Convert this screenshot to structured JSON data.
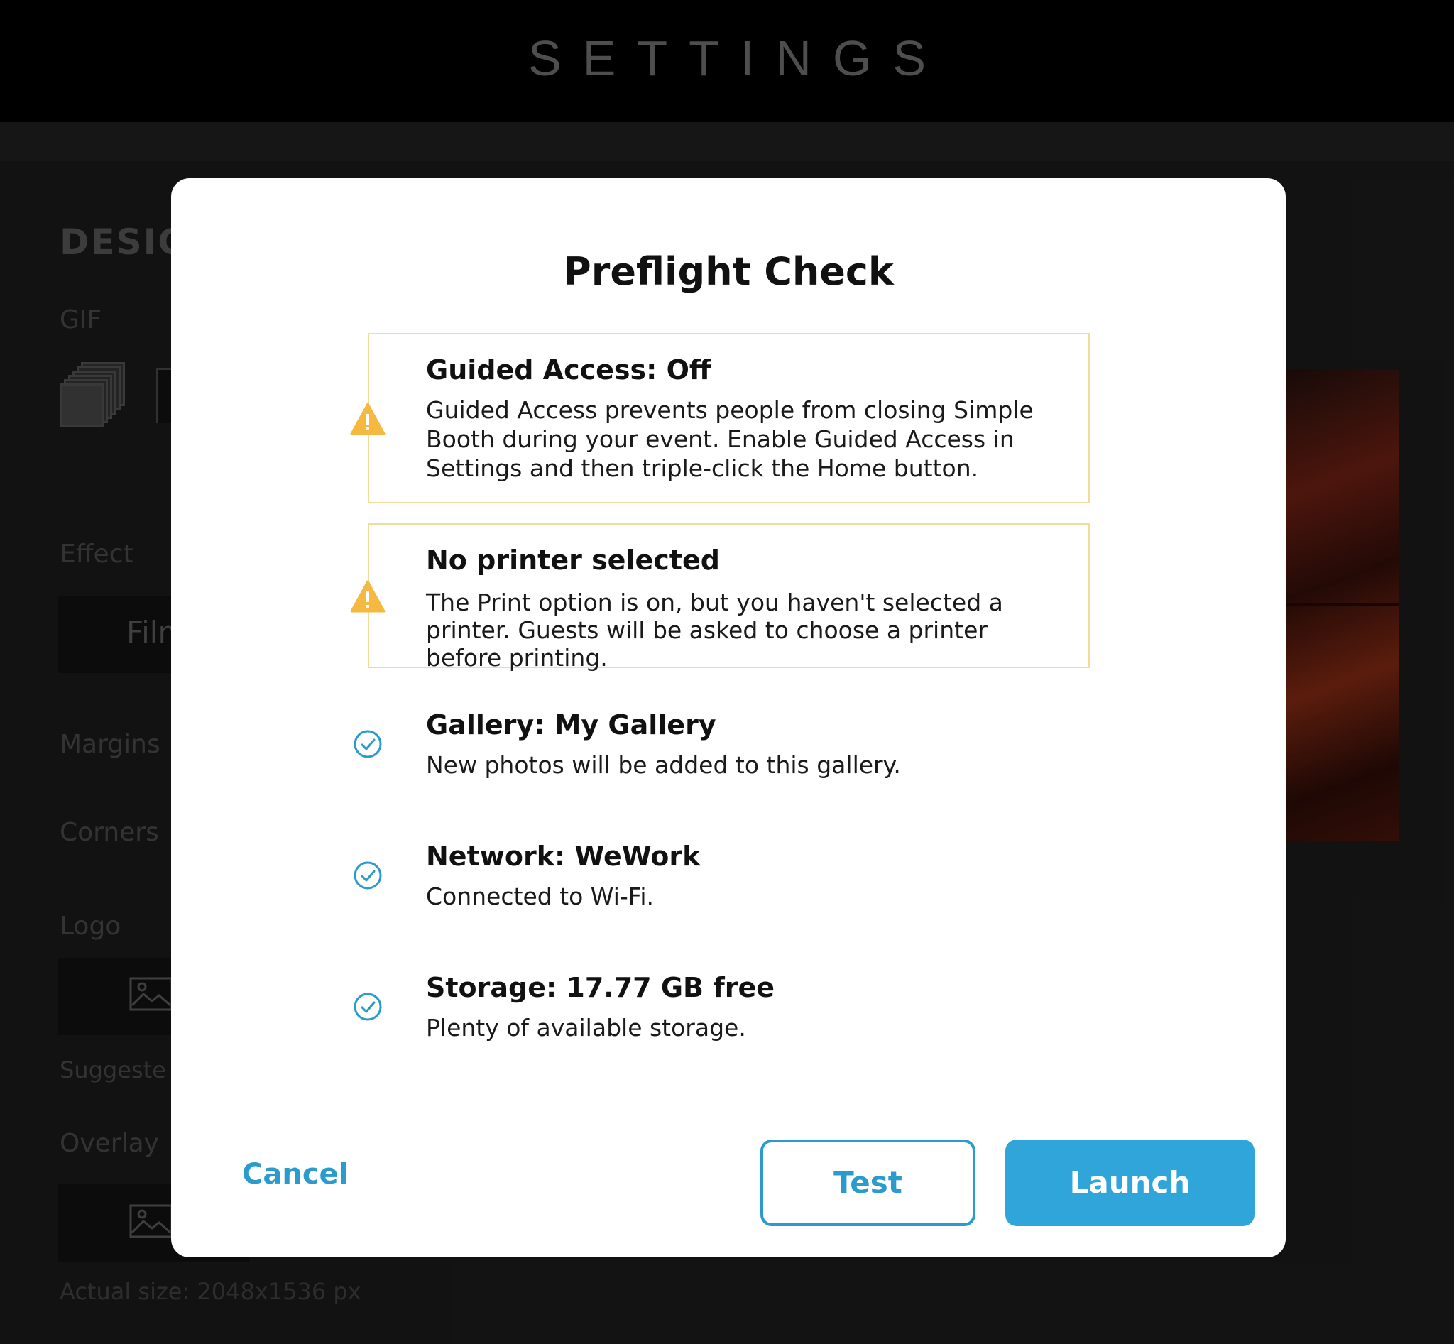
{
  "app": {
    "title": "SETTINGS"
  },
  "background": {
    "section_heading": "DESIG",
    "labels": {
      "gif": "GIF",
      "effect": "Effect",
      "effect_value": "Film",
      "margins": "Margins",
      "corners": "Corners",
      "logo": "Logo",
      "suggested": "Suggeste",
      "overlay": "Overlay",
      "actual_size": "Actual size: 2048x1536 px"
    }
  },
  "modal": {
    "title": "Preflight Check",
    "items": [
      {
        "status": "warning",
        "icon": "warning-icon",
        "title": "Guided Access: Off",
        "body": "Guided Access prevents people from closing Simple Booth during your event. Enable Guided Access in Settings and then triple-click the Home button."
      },
      {
        "status": "warning",
        "icon": "warning-icon",
        "title": "No printer selected",
        "body": "The Print option is on, but you haven't selected a printer. Guests will be asked to choose a printer before printing."
      },
      {
        "status": "ok",
        "icon": "check-circle-icon",
        "title": "Gallery: My Gallery",
        "body": "New photos will be added to this gallery."
      },
      {
        "status": "ok",
        "icon": "check-circle-icon",
        "title": "Network: WeWork",
        "body": "Connected to Wi-Fi."
      },
      {
        "status": "ok",
        "icon": "check-circle-icon",
        "title": "Storage: 17.77 GB free",
        "body": "Plenty of available storage."
      }
    ],
    "buttons": {
      "cancel": "Cancel",
      "test": "Test",
      "launch": "Launch"
    }
  },
  "colors": {
    "accent": "#2fa5da",
    "warning": "#f5b942",
    "warning_border": "#f3dc9a",
    "check": "#2a9bcc"
  }
}
